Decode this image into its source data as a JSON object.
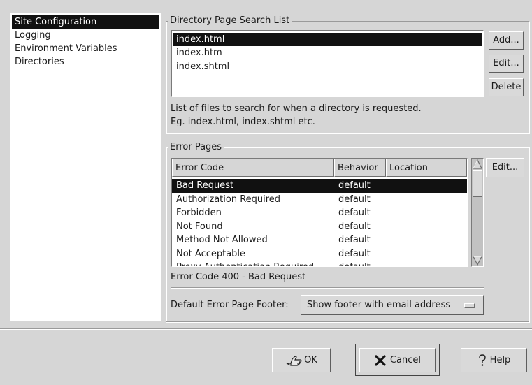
{
  "sidebar": {
    "items": [
      {
        "label": "Site Configuration",
        "selected": true
      },
      {
        "label": "Logging"
      },
      {
        "label": "Environment Variables"
      },
      {
        "label": "Directories"
      }
    ]
  },
  "directory_search": {
    "title": "Directory Page Search List",
    "files": [
      "index.html",
      "index.htm",
      "index.shtml"
    ],
    "selected_index": 0,
    "buttons": {
      "add": "Add...",
      "edit": "Edit...",
      "delete": "Delete"
    },
    "hint_line1": "List of files to search for when a directory is requested.",
    "hint_line2": "Eg. index.html, index.shtml etc."
  },
  "error_pages": {
    "title": "Error Pages",
    "columns": [
      "Error Code",
      "Behavior",
      "Location"
    ],
    "rows": [
      {
        "code": "Bad Request",
        "behavior": "default",
        "location": ""
      },
      {
        "code": "Authorization Required",
        "behavior": "default",
        "location": ""
      },
      {
        "code": "Forbidden",
        "behavior": "default",
        "location": ""
      },
      {
        "code": "Not Found",
        "behavior": "default",
        "location": ""
      },
      {
        "code": "Method Not Allowed",
        "behavior": "default",
        "location": ""
      },
      {
        "code": "Not Acceptable",
        "behavior": "default",
        "location": ""
      },
      {
        "code": "Proxy Authentication Required",
        "behavior": "default",
        "location": ""
      }
    ],
    "edit_button": "Edit...",
    "status": "Error Code 400 - Bad Request",
    "footer_label": "Default Error Page Footer:",
    "footer_value": "Show footer with email address"
  },
  "dialog_buttons": {
    "ok": "OK",
    "cancel": "Cancel",
    "help": "Help"
  }
}
